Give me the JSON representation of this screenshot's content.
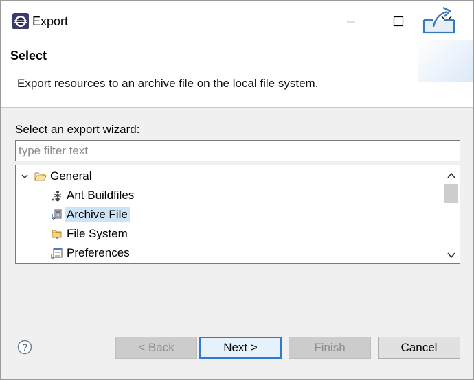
{
  "window": {
    "title": "Export",
    "controls": {
      "minimize": "minimize-icon",
      "maximize": "maximize-icon",
      "close": "close-icon"
    }
  },
  "header": {
    "title": "Select",
    "description": "Export resources to an archive file on the local file system."
  },
  "wizard": {
    "label": "Select an export wizard:",
    "filter_placeholder": "type filter text",
    "filter_value": ""
  },
  "tree": {
    "items": [
      {
        "label": "General",
        "icon": "open-folder-icon",
        "expanded": true
      },
      {
        "label": "Ant Buildfiles",
        "icon": "ant-icon"
      },
      {
        "label": "Archive File",
        "icon": "archive-icon",
        "selected": true
      },
      {
        "label": "File System",
        "icon": "folder-icon"
      },
      {
        "label": "Preferences",
        "icon": "preferences-icon"
      }
    ]
  },
  "buttons": {
    "back": "< Back",
    "next": "Next >",
    "finish": "Finish",
    "cancel": "Cancel"
  },
  "colors": {
    "selection": "#cce4f7",
    "primary_border": "#2f7ad1",
    "dialog_bg": "#f0f0f0"
  }
}
